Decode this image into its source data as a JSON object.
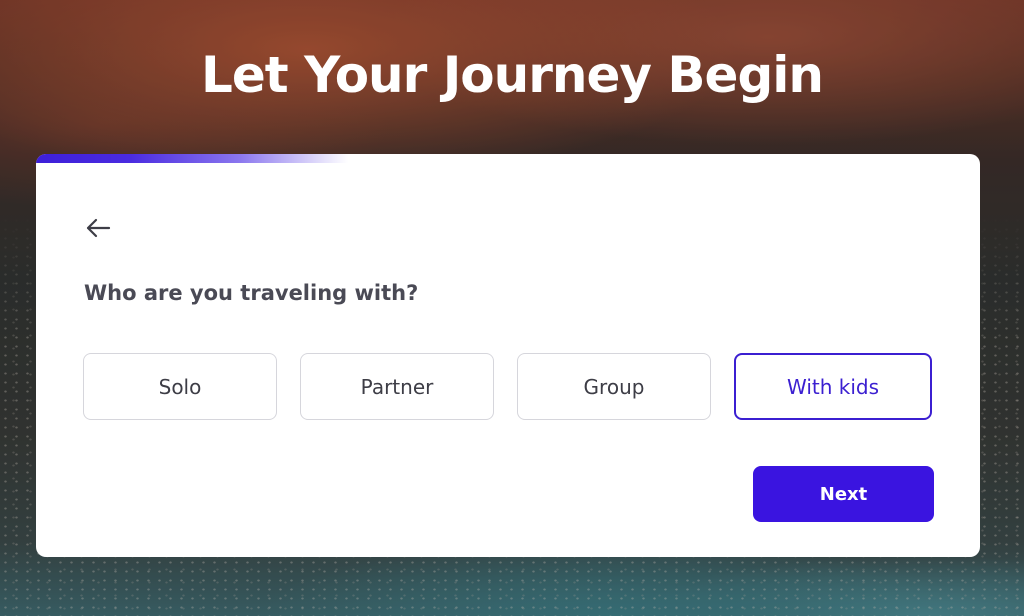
{
  "hero": {
    "title": "Let Your Journey Begin"
  },
  "wizard": {
    "progress": 0.33,
    "progress_color": "#3d1fd9",
    "back_icon": "arrow-left-icon",
    "question": "Who are you traveling with?",
    "options": [
      {
        "label": "Solo",
        "selected": false
      },
      {
        "label": "Partner",
        "selected": false
      },
      {
        "label": "Group",
        "selected": false
      },
      {
        "label": "With kids",
        "selected": true
      }
    ],
    "selected_color": "#3b1fd1",
    "next_label": "Next",
    "next_color": "#3a14e0"
  }
}
